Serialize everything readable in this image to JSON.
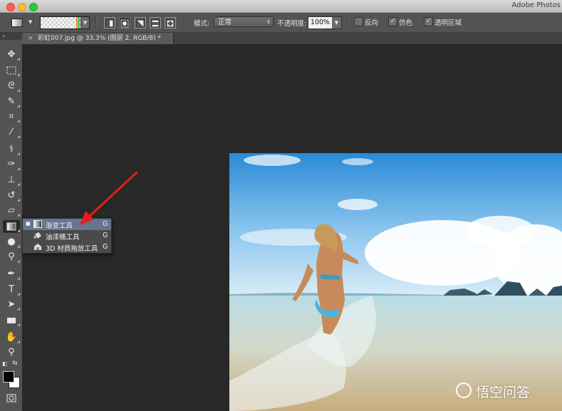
{
  "window": {
    "app_title": "Adobe Photos"
  },
  "options_bar": {
    "mode_label": "模式:",
    "mode_value": "正常",
    "opacity_label": "不透明度:",
    "opacity_value": "100%",
    "reverse_label": "反向",
    "reverse_checked": false,
    "dither_label": "仿色",
    "dither_checked": true,
    "transparency_label": "透明区域",
    "transparency_checked": true
  },
  "document_tab": {
    "title": "彩虹007.jpg @ 33.3% (图层 2, RGB/8) *"
  },
  "tool_flyout": {
    "items": [
      {
        "label": "渐变工具",
        "shortcut": "G",
        "selected": true,
        "icon": "gradient-icon"
      },
      {
        "label": "油漆桶工具",
        "shortcut": "G",
        "selected": false,
        "icon": "paint-bucket-icon"
      },
      {
        "label": "3D 材质拖放工具",
        "shortcut": "G",
        "selected": false,
        "icon": "3d-material-drop-icon"
      }
    ]
  },
  "watermark": {
    "text": "悟空问答"
  },
  "colors": {
    "panel": "#535353",
    "canvas": "#282828",
    "flyout_selected": "#667590",
    "annotation_arrow": "#e41f1f"
  }
}
